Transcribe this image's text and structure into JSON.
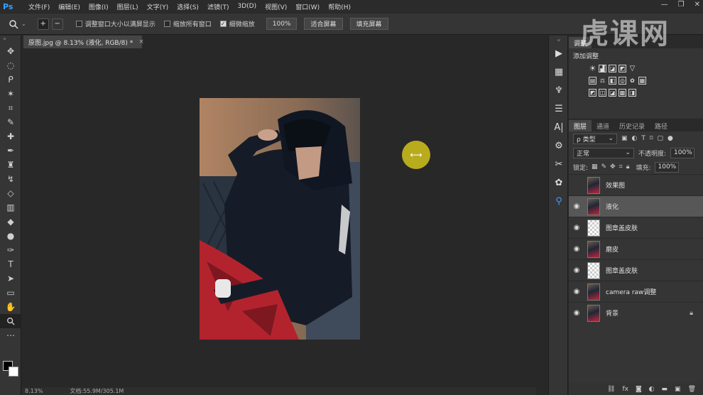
{
  "app": {
    "logo_text": "Ps"
  },
  "menu": [
    "文件(F)",
    "编辑(E)",
    "图像(I)",
    "图层(L)",
    "文字(Y)",
    "选择(S)",
    "滤镜(T)",
    "3D(D)",
    "视图(V)",
    "窗口(W)",
    "帮助(H)"
  ],
  "window_controls": [
    "—",
    "❐",
    "✕"
  ],
  "options": {
    "resize_windows": "调整窗口大小以满屏显示",
    "zoom_all_windows": "缩放所有窗口",
    "scrubby_zoom": "细微缩放",
    "zoom_percent": "100%",
    "fit_screen": "适合屏幕",
    "fill_screen": "填充屏幕"
  },
  "document": {
    "tab_title": "原图.jpg @ 8.13% (液化, RGB/8) *",
    "close": "×",
    "status_zoom": "8.13%",
    "status_doc": "文档:55.9M/305.1M"
  },
  "adjustments": {
    "tab": "调整",
    "add_label": "添加调整"
  },
  "layers_panel": {
    "tabs": [
      "图层",
      "通道",
      "历史记录",
      "路径"
    ],
    "filter_kind": "ρ 类型",
    "blend_mode": "正常",
    "opacity_label": "不透明度:",
    "opacity_value": "100%",
    "lock_label": "锁定:",
    "fill_label": "填充:",
    "fill_value": "100%",
    "layers": [
      {
        "name": "效果图",
        "visible": false,
        "thumb": "photo",
        "selected": false
      },
      {
        "name": "液化",
        "visible": true,
        "thumb": "photo",
        "selected": true
      },
      {
        "name": "图章盖皮肤",
        "visible": true,
        "thumb": "checker",
        "selected": false
      },
      {
        "name": "磨皮",
        "visible": true,
        "thumb": "photo",
        "selected": false
      },
      {
        "name": "图章盖皮肤",
        "visible": true,
        "thumb": "checker",
        "selected": false
      },
      {
        "name": "camera raw调整",
        "visible": true,
        "thumb": "photo",
        "selected": false
      },
      {
        "name": "背景",
        "visible": true,
        "thumb": "photo",
        "selected": false,
        "locked": true
      }
    ]
  },
  "watermark": "虎课网"
}
